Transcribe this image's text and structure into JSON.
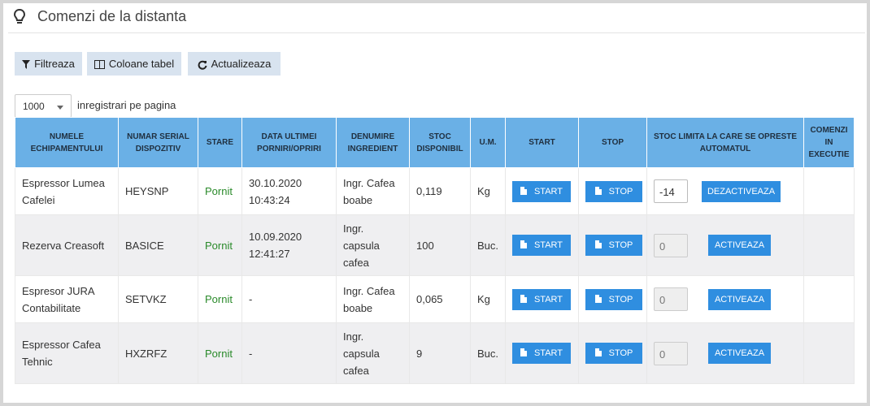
{
  "header": {
    "title": "Comenzi de la distanta",
    "icon": "lightbulb-icon"
  },
  "toolbar": {
    "filter_label": "Filtreaza",
    "columns_label": "Coloane tabel",
    "refresh_label": "Actualizeaza"
  },
  "pager": {
    "page_size": "1000",
    "label": "inregistrari pe pagina"
  },
  "table": {
    "headers": [
      "NUMELE ECHIPAMENTULUI",
      "NUMAR SERIAL DISPOZITIV",
      "STARE",
      "DATA ULTIMEI PORNIRI/OPRIRI",
      "DENUMIRE INGREDIENT",
      "STOC DISPONIBIL",
      "U.M.",
      "START",
      "STOP",
      "STOC LIMITA LA CARE SE OPRESTE AUTOMATUL",
      "COMENZI IN EXECUTIE"
    ],
    "rows": [
      {
        "name": "Espressor Lumea Cafelei",
        "serial": "HEYSNP",
        "state": "Pornit",
        "date": "30.10.2020 10:43:24",
        "ingredient": "Ingr. Cafea boabe",
        "stock": "0,119",
        "um": "Kg",
        "start": "START",
        "stop": "STOP",
        "limit": "-14",
        "limit_action": "DEZACTIVEAZA",
        "orders": ""
      },
      {
        "name": "Rezerva Creasoft",
        "serial": "BASICE",
        "state": "Pornit",
        "date": "10.09.2020 12:41:27",
        "ingredient": "Ingr. capsula cafea",
        "stock": "100",
        "um": "Buc.",
        "start": "START",
        "stop": "STOP",
        "limit": "0",
        "limit_action": "ACTIVEAZA",
        "orders": ""
      },
      {
        "name": "Espresor JURA Contabilitate",
        "serial": "SETVKZ",
        "state": "Pornit",
        "date": "-",
        "ingredient": "Ingr. Cafea boabe",
        "stock": "0,065",
        "um": "Kg",
        "start": "START",
        "stop": "STOP",
        "limit": "0",
        "limit_action": "ACTIVEAZA",
        "orders": ""
      },
      {
        "name": "Espressor Cafea Tehnic",
        "serial": "HXZRFZ",
        "state": "Pornit",
        "date": "-",
        "ingredient": "Ingr. capsula cafea",
        "stock": "9",
        "um": "Buc.",
        "start": "START",
        "stop": "STOP",
        "limit": "0",
        "limit_action": "ACTIVEAZA",
        "orders": ""
      }
    ]
  },
  "colors": {
    "header_bg": "#6ab0e6",
    "button_bg": "#2f8ee0",
    "toolbar_bg": "#d8e3ef",
    "status_green": "#2a8a2a"
  }
}
